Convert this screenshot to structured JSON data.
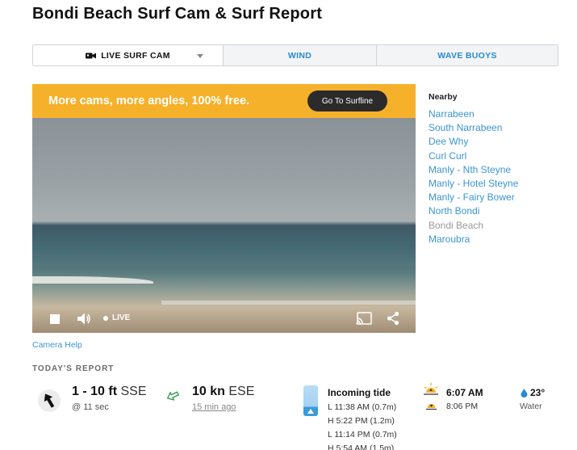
{
  "page": {
    "title": "Bondi Beach Surf Cam & Surf Report"
  },
  "tabs": [
    {
      "label": "LIVE SURF CAM",
      "icon": "video-camera-icon",
      "active": true
    },
    {
      "label": "WIND",
      "active": false
    },
    {
      "label": "WAVE BUOYS",
      "active": false
    }
  ],
  "banner": {
    "text": "More cams, more angles, 100% free.",
    "button": "Go To Surfline",
    "color": "#f6b12a"
  },
  "player": {
    "live_label": "LIVE"
  },
  "nearby": {
    "title": "Nearby",
    "items": [
      "Narrabeen",
      "South Narrabeen",
      "Dee Why",
      "Curl Curl",
      "Manly - Nth Steyne",
      "Manly - Hotel Steyne",
      "Manly - Fairy Bower",
      "North Bondi",
      "Bondi Beach",
      "Maroubra"
    ],
    "current": "Bondi Beach"
  },
  "camera_help": "Camera Help",
  "report": {
    "heading": "TODAY'S REPORT",
    "swell": {
      "height": "1 - 10 ft",
      "direction": "SSE",
      "period": "@ 11 sec"
    },
    "wind": {
      "speed": "10 kn",
      "direction": "ESE",
      "updated": "15 min ago"
    },
    "tide": {
      "title": "Incoming tide",
      "times": [
        "L 11:38 AM (0.7m)",
        "H 5:22 PM (1.2m)",
        "L 11:14 PM (0.7m)",
        "H 5:54 AM (1.5m)"
      ]
    },
    "sun": {
      "sunrise": "6:07 AM",
      "sunset": "8:06 PM"
    },
    "water": {
      "temp": "23°",
      "label": "Water"
    }
  },
  "colors": {
    "link": "#3b95d1",
    "banner": "#f6b12a",
    "tab_inactive": "#2a8ad0"
  }
}
